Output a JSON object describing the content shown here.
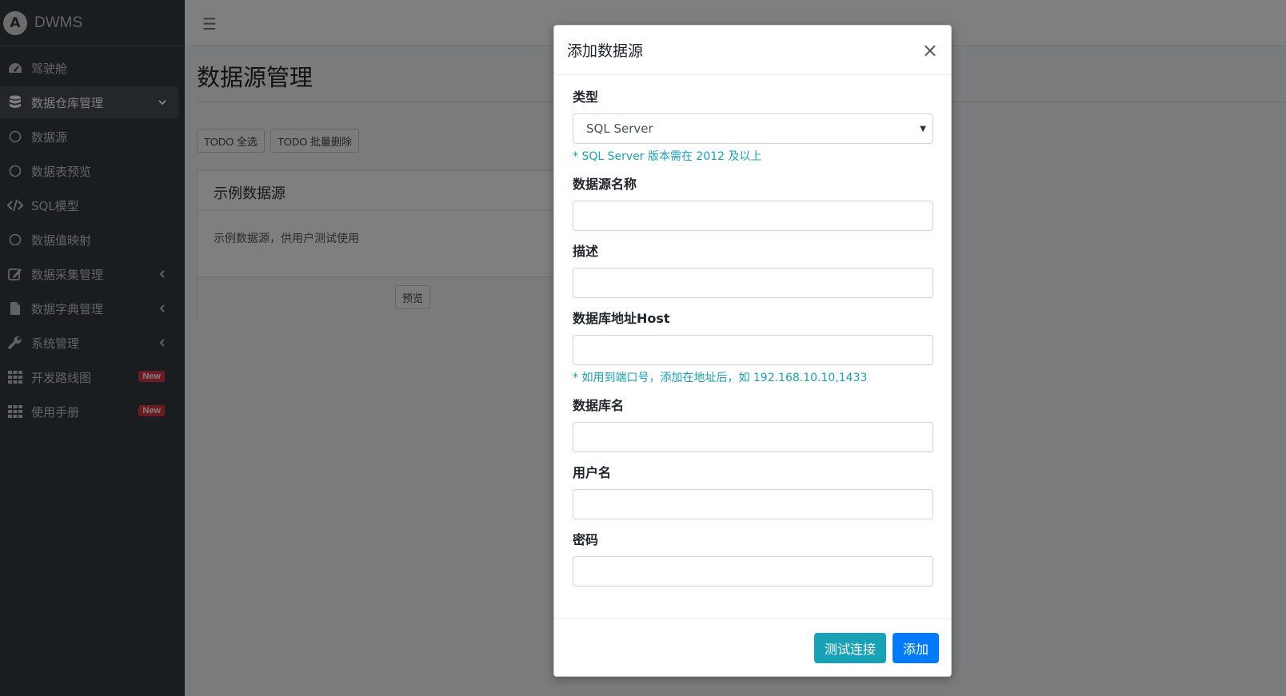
{
  "brand": {
    "logo_letter": "A",
    "name": "DWMS"
  },
  "sidebar": {
    "items": [
      {
        "label": "驾驶舱",
        "icon": "dashboard-icon"
      },
      {
        "label": "数据仓库管理",
        "icon": "database-icon",
        "active": true,
        "arrow": "chevron-down-icon"
      },
      {
        "label": "数据源",
        "icon": "circle-icon"
      },
      {
        "label": "数据表预览",
        "icon": "circle-icon"
      },
      {
        "label": "SQL模型",
        "icon": "code-icon"
      },
      {
        "label": "数据值映射",
        "icon": "circle-icon"
      },
      {
        "label": "数据采集管理",
        "icon": "edit-icon",
        "arrow": "chevron-left-icon"
      },
      {
        "label": "数据字典管理",
        "icon": "file-icon",
        "arrow": "chevron-left-icon"
      },
      {
        "label": "系统管理",
        "icon": "wrench-icon",
        "arrow": "chevron-left-icon"
      },
      {
        "label": "开发路线图",
        "icon": "grid-icon",
        "badge": "New"
      },
      {
        "label": "使用手册",
        "icon": "grid-icon",
        "badge": "New"
      }
    ]
  },
  "topbar": {
    "menu_icon": "☰"
  },
  "page": {
    "title": "数据源管理",
    "select_all_label": "TODO 全选",
    "batch_delete_label": "TODO 批量删除",
    "card": {
      "title": "示例数据源",
      "description": "示例数据源，供用户测试使用",
      "preview_label": "预览"
    }
  },
  "modal": {
    "title": "添加数据源",
    "close_symbol": "×",
    "type_label": "类型",
    "type_value": "SQL Server",
    "type_help": "* SQL Server 版本需在 2012 及以上",
    "name_label": "数据源名称",
    "name_value": "",
    "desc_label": "描述",
    "desc_value": "",
    "host_label": "数据库地址Host",
    "host_value": "",
    "host_help": "* 如用到端口号，添加在地址后，如 192.168.10.10,1433",
    "dbname_label": "数据库名",
    "dbname_value": "",
    "user_label": "用户名",
    "user_value": "",
    "password_label": "密码",
    "password_value": "",
    "test_button": "测试连接",
    "add_button": "添加"
  }
}
